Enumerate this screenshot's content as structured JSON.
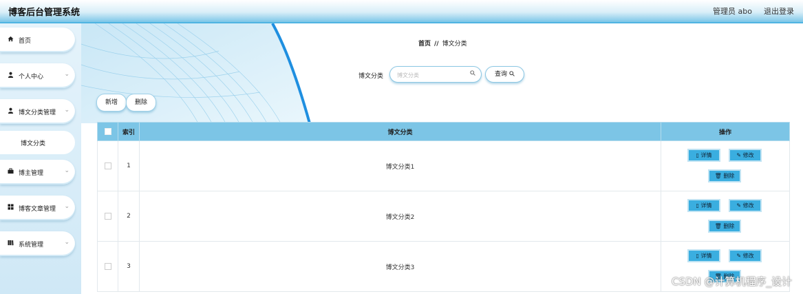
{
  "header": {
    "title": "博客后台管理系统",
    "admin_label": "管理员 abo",
    "logout_label": "退出登录"
  },
  "sidebar": {
    "items": [
      {
        "label": "首页",
        "icon": "home-icon"
      },
      {
        "label": "个人中心",
        "icon": "user-icon"
      },
      {
        "label": "博文分类管理",
        "icon": "user-icon"
      },
      {
        "label": "博主管理",
        "icon": "briefcase-icon"
      },
      {
        "label": "博客文章管理",
        "icon": "grid-icon"
      },
      {
        "label": "系统管理",
        "icon": "book-icon"
      }
    ],
    "sub_item": "博文分类"
  },
  "breadcrumb": {
    "home": "首页",
    "separator": "//",
    "current": "博文分类"
  },
  "search": {
    "label": "博文分类",
    "placeholder": "博文分类",
    "value": "",
    "button_label": "查询"
  },
  "toolbar": {
    "add_label": "新增",
    "delete_label": "删除"
  },
  "table": {
    "headers": {
      "index": "索引",
      "category": "博文分类",
      "actions": "操作"
    },
    "rows": [
      {
        "index": "1",
        "category": "博文分类1"
      },
      {
        "index": "2",
        "category": "博文分类2"
      },
      {
        "index": "3",
        "category": "博文分类3"
      }
    ],
    "action_labels": {
      "detail": "详情",
      "edit": "修改",
      "delete": "删除"
    }
  },
  "watermark": "CSDN @计算机程序_设计",
  "colors": {
    "accent": "#3aaee0",
    "header_bg": "#7cc5e6",
    "sidebar_bg": "#d9eef8"
  }
}
